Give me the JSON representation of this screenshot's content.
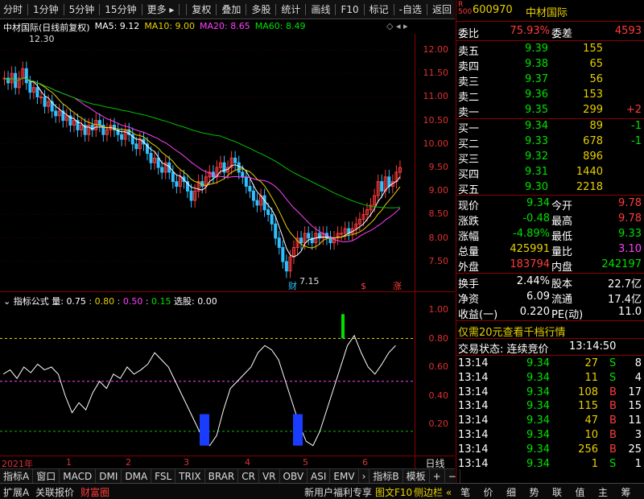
{
  "toolbar": {
    "left": [
      "分时",
      "1分钟",
      "5分钟",
      "15分钟",
      "更多 ▸"
    ],
    "right": [
      "复权",
      "叠加",
      "多股",
      "统计",
      "画线",
      "F10",
      "标记",
      "-自选",
      "返回"
    ]
  },
  "chart_title": {
    "name": "中材国际(日线前复权)",
    "ma5": "MA5: 9.12",
    "ma10": "MA10: 9.00",
    "ma20": "MA20: 8.65",
    "ma60": "MA60: 8.49",
    "high_mark": "12.30",
    "low_mark": "7.15",
    "marker_cai": "财",
    "marker_s": "$",
    "marker_zhang": "涨"
  },
  "price_axis": [
    "12.00",
    "11.50",
    "11.00",
    "10.50",
    "10.00",
    "9.50",
    "9.00",
    "8.50",
    "8.00",
    "7.50"
  ],
  "indicator": {
    "title": "指标公式",
    "qty_label": "量:",
    "v1": "0.75",
    "v2": "0.80",
    "v3": "0.50",
    "v4": "0.15",
    "pick": "选股: 0.00",
    "axis": [
      "1.00",
      "0.80",
      "0.60",
      "0.40",
      "0.20"
    ]
  },
  "date_axis": {
    "year": "2021年",
    "months": [
      "1",
      "2",
      "3",
      "4",
      "5",
      "6"
    ]
  },
  "day_button": "日线",
  "ind_tabs": [
    "指标A",
    "窗口",
    "MACD",
    "DMI",
    "DMA",
    "FSL",
    "TRIX",
    "BRAR",
    "CR",
    "VR",
    "OBV",
    "ASI",
    "EMV",
    "›",
    "指标B",
    "模板",
    "+",
    "−"
  ],
  "bottom_bar": {
    "left": [
      "扩展A",
      "关联报价",
      "财富圈"
    ],
    "mid": [
      "新用户福利专享",
      "图文F10",
      "侧边栏 «"
    ],
    "right": [
      "笔",
      "价",
      "细",
      "势",
      "联",
      "值",
      "主",
      "筹"
    ]
  },
  "quote": {
    "code": "600970",
    "name": "中材国际",
    "r_badge": "R",
    "r_sub": "500",
    "wei_bi_label": "委比",
    "wei_bi": "75.93%",
    "wei_cha_label": "委差",
    "wei_cha": "4593",
    "asks": [
      {
        "label": "卖五",
        "price": "9.39",
        "vol": "155",
        "chg": ""
      },
      {
        "label": "卖四",
        "price": "9.38",
        "vol": "65",
        "chg": ""
      },
      {
        "label": "卖三",
        "price": "9.37",
        "vol": "56",
        "chg": ""
      },
      {
        "label": "卖二",
        "price": "9.36",
        "vol": "153",
        "chg": ""
      },
      {
        "label": "卖一",
        "price": "9.35",
        "vol": "299",
        "chg": "+2"
      }
    ],
    "bids": [
      {
        "label": "买一",
        "price": "9.34",
        "vol": "89",
        "chg": "-1"
      },
      {
        "label": "买二",
        "price": "9.33",
        "vol": "678",
        "chg": "-1"
      },
      {
        "label": "买三",
        "price": "9.32",
        "vol": "896",
        "chg": ""
      },
      {
        "label": "买四",
        "price": "9.31",
        "vol": "1440",
        "chg": ""
      },
      {
        "label": "买五",
        "price": "9.30",
        "vol": "2218",
        "chg": ""
      }
    ],
    "stats": [
      {
        "l1": "现价",
        "v1": "9.34",
        "l2": "今开",
        "v2": "9.78"
      },
      {
        "l1": "涨跌",
        "v1": "-0.48",
        "l2": "最高",
        "v2": "9.78"
      },
      {
        "l1": "涨幅",
        "v1": "-4.89%",
        "l2": "最低",
        "v2": "9.33"
      },
      {
        "l1": "总量",
        "v1": "425991",
        "l2": "量比",
        "v2": "3.10"
      },
      {
        "l1": "外盘",
        "v1": "183794",
        "l2": "内盘",
        "v2": "242197"
      }
    ],
    "stats2": [
      {
        "l1": "换手",
        "v1": "2.44%",
        "l2": "股本",
        "v2": "22.7亿"
      },
      {
        "l1": "净资",
        "v1": "6.09",
        "l2": "流通",
        "v2": "17.4亿"
      },
      {
        "l1": "收益(一)",
        "v1": "0.220",
        "l2": "PE(动)",
        "v2": "11.0"
      }
    ],
    "promo": "仅需20元查看千档行情",
    "trade_state_label": "交易状态: 连续竞价",
    "trade_state_time": "13:14:50",
    "ticks": [
      {
        "t": "13:14",
        "p": "9.34",
        "v": "27",
        "d": "S",
        "n": "8"
      },
      {
        "t": "13:14",
        "p": "9.34",
        "v": "11",
        "d": "S",
        "n": "4"
      },
      {
        "t": "13:14",
        "p": "9.34",
        "v": "108",
        "d": "B",
        "n": "17"
      },
      {
        "t": "13:14",
        "p": "9.34",
        "v": "115",
        "d": "B",
        "n": "15"
      },
      {
        "t": "13:14",
        "p": "9.34",
        "v": "47",
        "d": "B",
        "n": "11"
      },
      {
        "t": "13:14",
        "p": "9.34",
        "v": "10",
        "d": "B",
        "n": "3"
      },
      {
        "t": "13:14",
        "p": "9.34",
        "v": "256",
        "d": "B",
        "n": "25"
      },
      {
        "t": "13:14",
        "p": "9.34",
        "v": "1",
        "d": "S",
        "n": "1"
      }
    ]
  }
}
